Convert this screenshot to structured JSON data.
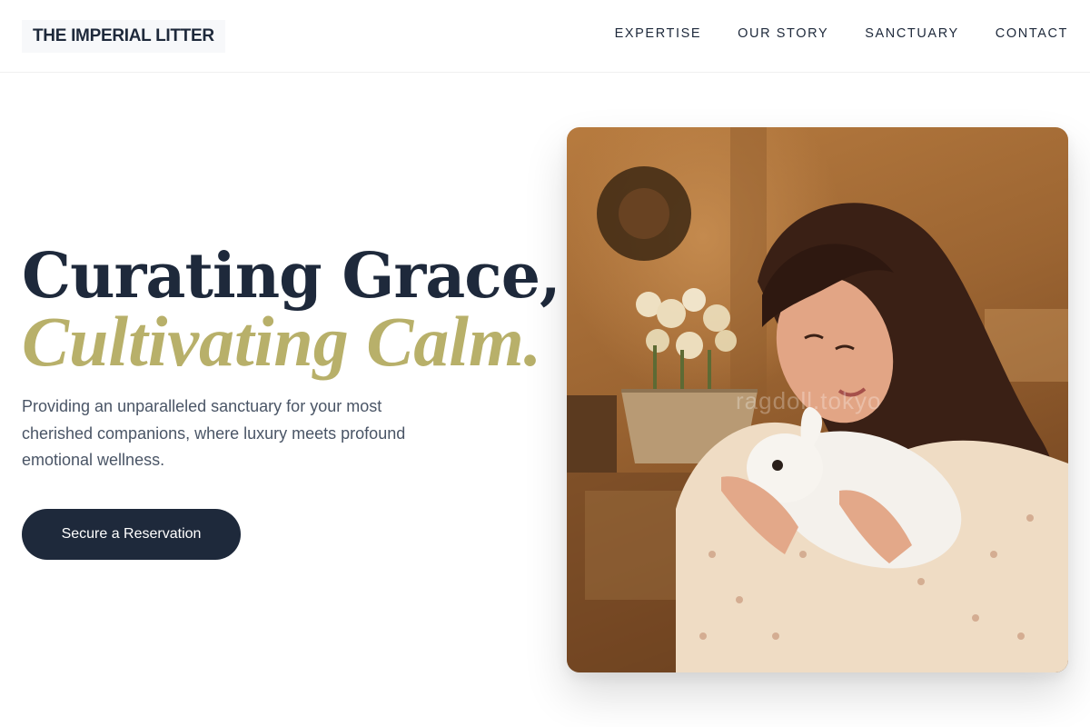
{
  "header": {
    "logo": "THE IMPERIAL LITTER",
    "nav": [
      {
        "label": "EXPERTISE"
      },
      {
        "label": "OUR STORY"
      },
      {
        "label": "SANCTUARY"
      },
      {
        "label": "CONTACT"
      }
    ]
  },
  "hero": {
    "headline_line1": "Curating Grace,",
    "headline_line2": "Cultivating Calm.",
    "subtext": "Providing an unparalleled sanctuary for your most cherished companions, where luxury meets profound emotional wellness.",
    "cta_label": "Secure a Reservation",
    "image": {
      "watermark": "ragdoll.tokyo"
    }
  },
  "colors": {
    "navy": "#1e293b",
    "gold": "#b8b06a",
    "body_text": "#4a5566",
    "white": "#ffffff"
  }
}
